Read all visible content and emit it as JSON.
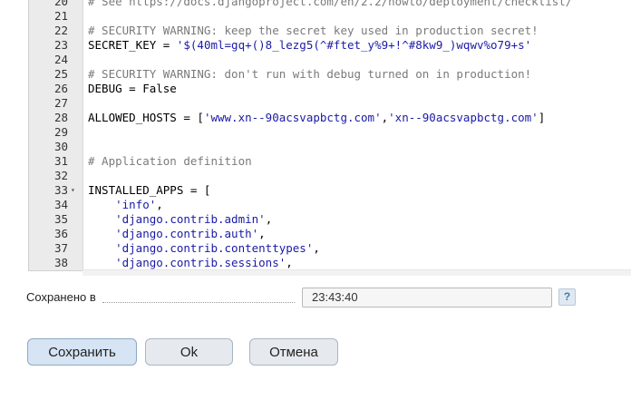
{
  "editor": {
    "lines": [
      {
        "num": "20",
        "fold": "",
        "segments": [
          {
            "t": "# See https://docs.djangoproject.com/en/2.2/howto/deployment/checklist/",
            "c": "cmt"
          }
        ]
      },
      {
        "num": "21",
        "fold": "",
        "segments": []
      },
      {
        "num": "22",
        "fold": "",
        "segments": [
          {
            "t": "# SECURITY WARNING: keep the secret key used in production secret!",
            "c": "cmt"
          }
        ]
      },
      {
        "num": "23",
        "fold": "",
        "segments": [
          {
            "t": "SECRET_KEY = ",
            "c": "op"
          },
          {
            "t": "'$(40ml=gq+()8_lezg5(^#ftet_y%9+!^#8kw9_)wqwv%o79+s'",
            "c": "str"
          }
        ]
      },
      {
        "num": "24",
        "fold": "",
        "segments": []
      },
      {
        "num": "25",
        "fold": "",
        "segments": [
          {
            "t": "# SECURITY WARNING: don't run with debug turned on in production!",
            "c": "cmt"
          }
        ]
      },
      {
        "num": "26",
        "fold": "",
        "segments": [
          {
            "t": "DEBUG = False",
            "c": "op"
          }
        ]
      },
      {
        "num": "27",
        "fold": "",
        "segments": []
      },
      {
        "num": "28",
        "fold": "",
        "segments": [
          {
            "t": "ALLOWED_HOSTS = [",
            "c": "op"
          },
          {
            "t": "'www.xn--90acsvapbctg.com'",
            "c": "str"
          },
          {
            "t": ",",
            "c": "op"
          },
          {
            "t": "'xn--90acsvapbctg.com'",
            "c": "str"
          },
          {
            "t": "]",
            "c": "op"
          }
        ]
      },
      {
        "num": "29",
        "fold": "",
        "segments": []
      },
      {
        "num": "30",
        "fold": "",
        "segments": []
      },
      {
        "num": "31",
        "fold": "",
        "segments": [
          {
            "t": "# Application definition",
            "c": "cmt"
          }
        ]
      },
      {
        "num": "32",
        "fold": "",
        "segments": []
      },
      {
        "num": "33",
        "fold": "▾",
        "segments": [
          {
            "t": "INSTALLED_APPS = [",
            "c": "op"
          }
        ]
      },
      {
        "num": "34",
        "fold": "",
        "segments": [
          {
            "t": "    ",
            "c": "op"
          },
          {
            "t": "'info'",
            "c": "str"
          },
          {
            "t": ",",
            "c": "op"
          }
        ]
      },
      {
        "num": "35",
        "fold": "",
        "segments": [
          {
            "t": "    ",
            "c": "op"
          },
          {
            "t": "'django.contrib.admin'",
            "c": "str"
          },
          {
            "t": ",",
            "c": "op"
          }
        ]
      },
      {
        "num": "36",
        "fold": "",
        "segments": [
          {
            "t": "    ",
            "c": "op"
          },
          {
            "t": "'django.contrib.auth'",
            "c": "str"
          },
          {
            "t": ",",
            "c": "op"
          }
        ]
      },
      {
        "num": "37",
        "fold": "",
        "segments": [
          {
            "t": "    ",
            "c": "op"
          },
          {
            "t": "'django.contrib.contenttypes'",
            "c": "str"
          },
          {
            "t": ",",
            "c": "op"
          }
        ]
      },
      {
        "num": "38",
        "fold": "",
        "segments": [
          {
            "t": "    ",
            "c": "op"
          },
          {
            "t": "'django.contrib.sessions'",
            "c": "str"
          },
          {
            "t": ",",
            "c": "op"
          }
        ]
      }
    ]
  },
  "status": {
    "saved_label": "Сохранено в",
    "saved_time": "23:43:40",
    "help": "?"
  },
  "buttons": {
    "save": "Сохранить",
    "ok": "Ok",
    "cancel": "Отмена"
  }
}
